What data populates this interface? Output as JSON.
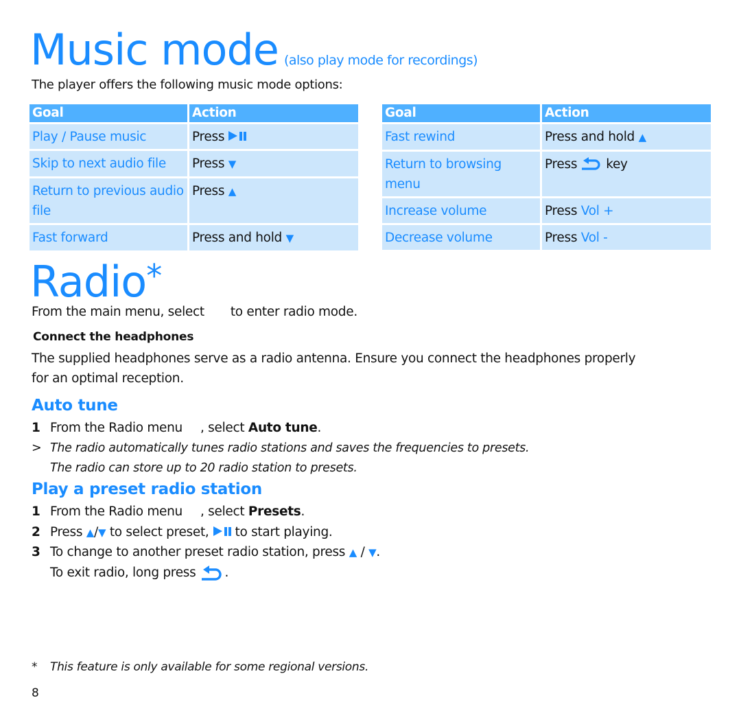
{
  "music_section": {
    "title": "Music mode",
    "subtitle": "(also play mode for recordings)",
    "intro": "The player offers the following music mode options:",
    "table_headers": {
      "goal": "Goal",
      "action": "Action"
    },
    "left_table": [
      {
        "goal": "Play / Pause music",
        "action_prefix": "Press",
        "action_icon": "play-pause-icon",
        "action_suffix": ""
      },
      {
        "goal": "Skip to next audio file",
        "action_prefix": "Press",
        "action_icon": "down-arrow-icon",
        "action_suffix": ""
      },
      {
        "goal": "Return to previous audio file",
        "action_prefix": "Press",
        "action_icon": "up-arrow-icon",
        "action_suffix": ""
      },
      {
        "goal": "Fast forward",
        "action_prefix": "Press and hold",
        "action_icon": "down-arrow-icon",
        "action_suffix": ""
      }
    ],
    "right_table": [
      {
        "goal": "Fast rewind",
        "action_prefix": "Press and hold",
        "action_icon": "up-arrow-icon",
        "action_suffix": ""
      },
      {
        "goal": "Return to browsing menu",
        "action_prefix": "Press",
        "action_icon": "back-arrow-icon",
        "action_suffix": "key"
      },
      {
        "goal": "Increase volume",
        "action_prefix": "Press",
        "action_highlight": "Vol +",
        "action_suffix": ""
      },
      {
        "goal": "Decrease volume",
        "action_prefix": "Press",
        "action_highlight": "Vol -",
        "action_suffix": ""
      }
    ]
  },
  "radio_section": {
    "title": "Radio",
    "title_mark": "*",
    "intro_before": "From the main menu, select",
    "intro_after": "to enter radio mode.",
    "connect_heading": "Connect the headphones",
    "connect_text_line1": "The supplied headphones serve as a radio antenna. Ensure you connect the headphones properly",
    "connect_text_line2": "for an optimal reception.",
    "auto_tune": {
      "heading": "Auto tune",
      "step1_num": "1",
      "step1_before": "From the Radio menu",
      "step1_mid": ", select",
      "step1_bold": "Auto tune",
      "step1_end": ".",
      "result_marker": ">",
      "result_line1": "The radio automatically tunes radio stations and saves the frequencies to presets.",
      "result_line2": "The radio can store up to 20 radio station to presets."
    },
    "preset": {
      "heading": "Play a preset radio station",
      "step1_num": "1",
      "step1_before": "From the Radio menu",
      "step1_mid": ", select",
      "step1_bold": "Presets",
      "step1_end": ".",
      "step2_num": "2",
      "step2_a": "Press",
      "step2_b": "to select preset,",
      "step2_c": "to start playing.",
      "step3_num": "3",
      "step3_a": "To change to another preset radio station, press",
      "step3_sep": "/",
      "step3_end": ".",
      "step3_line2": "To exit radio, long press",
      "step3_line2_end": "."
    }
  },
  "footer": {
    "footnote_mark": "*",
    "footnote_text": "This feature is only available for some regional versions.",
    "page_number": "8"
  },
  "colors": {
    "accent": "#1a8cff",
    "header_bg": "#4fb0ff",
    "cell_bg": "#cce6fc"
  }
}
